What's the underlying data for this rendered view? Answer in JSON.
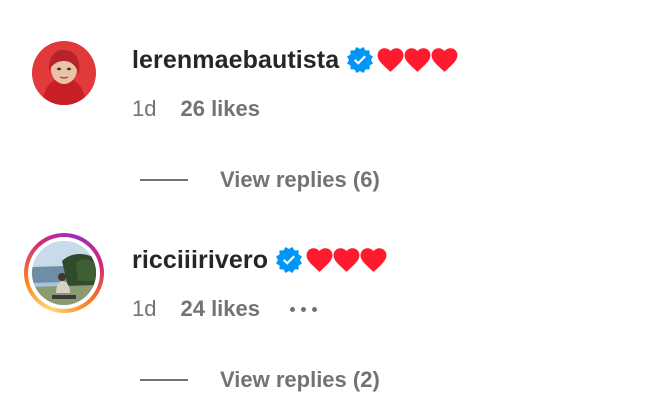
{
  "comments": [
    {
      "username": "lerenmaebautista",
      "verified": true,
      "text_icons": [
        "heart-icon",
        "heart-icon",
        "heart-icon"
      ],
      "time": "1d",
      "likes": "26 likes",
      "view_replies": "View replies (6)",
      "has_story_ring": false
    },
    {
      "username": "ricciiirivero",
      "verified": true,
      "text_icons": [
        "heart-icon",
        "heart-icon",
        "heart-icon"
      ],
      "time": "1d",
      "likes": "24 likes",
      "view_replies": "View replies (2)",
      "has_story_ring": true,
      "more_icon": "more-options-icon"
    }
  ],
  "colors": {
    "text_primary": "#262626",
    "text_secondary": "#737373",
    "verified_blue": "#0095f6",
    "heart_red": "#ff1a2e"
  }
}
